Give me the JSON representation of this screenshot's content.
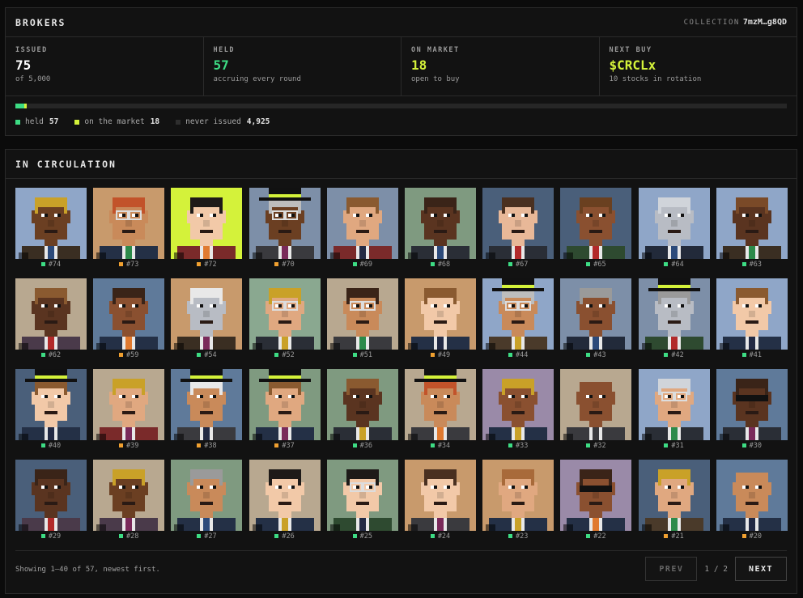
{
  "header": {
    "title": "BROKERS",
    "collection_label": "COLLECTION",
    "collection_id": "7mzM…g8QD"
  },
  "stats": [
    {
      "label": "ISSUED",
      "value": "75",
      "sub": "of 5,000",
      "color": "#ffffff"
    },
    {
      "label": "HELD",
      "value": "57",
      "sub": "accruing every round",
      "color": "#3ddc84"
    },
    {
      "label": "ON MARKET",
      "value": "18",
      "sub": "open to buy",
      "color": "#d4f23a"
    },
    {
      "label": "NEXT BUY",
      "value": "$CRCLx",
      "sub": "10 stocks in rotation",
      "color": "#d4f23a"
    }
  ],
  "supply": {
    "total": 5000,
    "held": 57,
    "market": 18
  },
  "legend": [
    {
      "label": "held",
      "value": "57",
      "color": "#3ddc84"
    },
    {
      "label": "on the market",
      "value": "18",
      "color": "#d4f23a"
    },
    {
      "label": "never issued",
      "value": "4,925",
      "color": "#2e2e2e"
    }
  ],
  "circulation": {
    "title": "IN CIRCULATION",
    "status_colors": {
      "held": "#3ddc84",
      "market": "#f0a030"
    },
    "items": [
      {
        "id": "#74",
        "status": "held",
        "bg": "#8fa6c8",
        "skin": "#6b3f22",
        "hair": "#c9a128",
        "suit": "#3a2e22",
        "tie": "#2c4a7a",
        "hat": "none",
        "glasses": false
      },
      {
        "id": "#73",
        "status": "market",
        "bg": "#c89a6c",
        "skin": "#c98a5a",
        "hair": "#c2532a",
        "suit": "#243046",
        "tie": "#2c8a4a",
        "hat": "none",
        "glasses": true
      },
      {
        "id": "#72",
        "status": "market",
        "bg": "#d4f23a",
        "skin": "#f2c9a8",
        "hair": "#1e1a18",
        "suit": "#7a2a2a",
        "tie": "#e07a30",
        "hat": "none",
        "glasses": false
      },
      {
        "id": "#70",
        "status": "market",
        "bg": "#7d8fa8",
        "skin": "#6b3f22",
        "hair": "#bdbdbd",
        "suit": "#3a3a3e",
        "tie": "#7a2a5a",
        "hat": "top",
        "glasses": true
      },
      {
        "id": "#69",
        "status": "held",
        "bg": "#7d8fa8",
        "skin": "#e0a880",
        "hair": "#8a5a30",
        "suit": "#7a2a2a",
        "tie": "#222a44",
        "hat": "none",
        "glasses": false
      },
      {
        "id": "#68",
        "status": "held",
        "bg": "#7f9a80",
        "skin": "#5a3420",
        "hair": "#3a2418",
        "suit": "#2a2e36",
        "tie": "#2c4a7a",
        "hat": "none",
        "glasses": false
      },
      {
        "id": "#67",
        "status": "held",
        "bg": "#4a5f7a",
        "skin": "#e8b898",
        "hair": "#4a3020",
        "suit": "#2a2e36",
        "tie": "#b22a2a",
        "hat": "none",
        "glasses": false
      },
      {
        "id": "#65",
        "status": "held",
        "bg": "#4a5f7a",
        "skin": "#8a5030",
        "hair": "#6a4020",
        "suit": "#2e4a30",
        "tie": "#b22a2a",
        "hat": "none",
        "glasses": false
      },
      {
        "id": "#64",
        "status": "held",
        "bg": "#8fa6c8",
        "skin": "#b8bcc4",
        "hair": "#d0d4da",
        "suit": "#222a3a",
        "tie": "#2c4a7a",
        "hat": "none",
        "glasses": false
      },
      {
        "id": "#63",
        "status": "held",
        "bg": "#8fa6c8",
        "skin": "#5a3420",
        "hair": "#7a4a28",
        "suit": "#3a2e22",
        "tie": "#2c8a4a",
        "hat": "none",
        "glasses": false
      },
      {
        "id": "#62",
        "status": "held",
        "bg": "#b8a890",
        "skin": "#5a3420",
        "hair": "#8a5a30",
        "suit": "#4a3a4a",
        "tie": "#b22a2a",
        "hat": "none",
        "glasses": false
      },
      {
        "id": "#59",
        "status": "market",
        "bg": "#5f7a9a",
        "skin": "#8a5030",
        "hair": "#3a2418",
        "suit": "#243046",
        "tie": "#e07a30",
        "hat": "none",
        "glasses": false
      },
      {
        "id": "#54",
        "status": "held",
        "bg": "#c89a6c",
        "skin": "#b8bcc4",
        "hair": "#e8e8e8",
        "suit": "#3a2e22",
        "tie": "#7a2a5a",
        "hat": "none",
        "glasses": false
      },
      {
        "id": "#52",
        "status": "held",
        "bg": "#8aa890",
        "skin": "#e0a880",
        "hair": "#c9a128",
        "suit": "#2a2e36",
        "tie": "#c9a128",
        "hat": "none",
        "glasses": true
      },
      {
        "id": "#51",
        "status": "held",
        "bg": "#b8a890",
        "skin": "#c98a5a",
        "hair": "#3a2418",
        "suit": "#3a3a3e",
        "tie": "#2c8a4a",
        "hat": "none",
        "glasses": true
      },
      {
        "id": "#49",
        "status": "market",
        "bg": "#c89a6c",
        "skin": "#f2c9a8",
        "hair": "#8a5a30",
        "suit": "#243046",
        "tie": "#222a44",
        "hat": "none",
        "glasses": false
      },
      {
        "id": "#44",
        "status": "held",
        "bg": "#8fa6c8",
        "skin": "#c98a5a",
        "hair": "#bdbdbd",
        "suit": "#4a3a2a",
        "tie": "#c9a128",
        "hat": "top",
        "glasses": true
      },
      {
        "id": "#43",
        "status": "held",
        "bg": "#7d8fa8",
        "skin": "#8a5030",
        "hair": "#9a9a9a",
        "suit": "#222a3a",
        "tie": "#2c4a7a",
        "hat": "none",
        "glasses": false
      },
      {
        "id": "#42",
        "status": "held",
        "bg": "#7d8fa8",
        "skin": "#b8bcc4",
        "hair": "#9a9a9a",
        "suit": "#2e4a30",
        "tie": "#b22a2a",
        "hat": "top",
        "glasses": false
      },
      {
        "id": "#41",
        "status": "held",
        "bg": "#8fa6c8",
        "skin": "#f2c9a8",
        "hair": "#8a5a30",
        "suit": "#243046",
        "tie": "#222a44",
        "hat": "none",
        "glasses": false
      },
      {
        "id": "#40",
        "status": "held",
        "bg": "#4a5f7a",
        "skin": "#f2c9a8",
        "hair": "#8a5a30",
        "suit": "#243046",
        "tie": "#222a44",
        "hat": "top",
        "glasses": false
      },
      {
        "id": "#39",
        "status": "market",
        "bg": "#b8a890",
        "skin": "#e0a880",
        "hair": "#c9a128",
        "suit": "#7a2a2a",
        "tie": "#7a2a5a",
        "hat": "none",
        "glasses": false
      },
      {
        "id": "#38",
        "status": "market",
        "bg": "#5f7a9a",
        "skin": "#c98a5a",
        "hair": "#e8e8e8",
        "suit": "#3a3a3e",
        "tie": "#222a44",
        "hat": "top",
        "glasses": false
      },
      {
        "id": "#37",
        "status": "market",
        "bg": "#7f9a80",
        "skin": "#e0a880",
        "hair": "#8a5a30",
        "suit": "#243046",
        "tie": "#7a2a5a",
        "hat": "top",
        "glasses": false
      },
      {
        "id": "#36",
        "status": "held",
        "bg": "#7f9a80",
        "skin": "#5a3420",
        "hair": "#8a5a30",
        "suit": "#2a2e36",
        "tie": "#c9a128",
        "hat": "none",
        "glasses": false
      },
      {
        "id": "#34",
        "status": "held",
        "bg": "#b8a890",
        "skin": "#c98a5a",
        "hair": "#c2532a",
        "suit": "#3a3a3e",
        "tie": "#e07a30",
        "hat": "top",
        "glasses": false
      },
      {
        "id": "#33",
        "status": "held",
        "bg": "#9a8aa8",
        "skin": "#8a5030",
        "hair": "#c9a128",
        "suit": "#243046",
        "tie": "#c9a128",
        "hat": "none",
        "glasses": false
      },
      {
        "id": "#32",
        "status": "held",
        "bg": "#b8a890",
        "skin": "#8a5030",
        "hair": "#8a5030",
        "suit": "#3a3a3e",
        "tie": "#3a3a3e",
        "hat": "none",
        "glasses": false
      },
      {
        "id": "#31",
        "status": "held",
        "bg": "#8fa6c8",
        "skin": "#e0a880",
        "hair": "#d0d4da",
        "suit": "#2a2e36",
        "tie": "#2c8a4a",
        "hat": "none",
        "glasses": true
      },
      {
        "id": "#30",
        "status": "held",
        "bg": "#5f7a9a",
        "skin": "#5a3420",
        "hair": "#3a2418",
        "suit": "#2a2e36",
        "tie": "#7a2a5a",
        "hat": "none",
        "glasses": "shades"
      },
      {
        "id": "#29",
        "status": "held",
        "bg": "#4a5f7a",
        "skin": "#5a3420",
        "hair": "#3a2418",
        "suit": "#4a3a4a",
        "tie": "#b22a2a",
        "hat": "none",
        "glasses": false
      },
      {
        "id": "#28",
        "status": "held",
        "bg": "#b8a890",
        "skin": "#6b3f22",
        "hair": "#c9a128",
        "suit": "#4a3a4a",
        "tie": "#7a2a5a",
        "hat": "none",
        "glasses": false
      },
      {
        "id": "#27",
        "status": "held",
        "bg": "#7f9a80",
        "skin": "#c98a5a",
        "hair": "#9a9a9a",
        "suit": "#243046",
        "tie": "#2c4a7a",
        "hat": "none",
        "glasses": false
      },
      {
        "id": "#26",
        "status": "held",
        "bg": "#b8a890",
        "skin": "#f2c9a8",
        "hair": "#1e1a18",
        "suit": "#243046",
        "tie": "#c9a128",
        "hat": "none",
        "glasses": false
      },
      {
        "id": "#25",
        "status": "held",
        "bg": "#7f9a80",
        "skin": "#f2c9a8",
        "hair": "#1e1a18",
        "suit": "#2e4a30",
        "tie": "#222a44",
        "hat": "none",
        "glasses": true
      },
      {
        "id": "#24",
        "status": "held",
        "bg": "#c89a6c",
        "skin": "#f2c9a8",
        "hair": "#4a3020",
        "suit": "#3a3a3e",
        "tie": "#7a2a5a",
        "hat": "none",
        "glasses": false
      },
      {
        "id": "#23",
        "status": "held",
        "bg": "#c89a6c",
        "skin": "#e0a880",
        "hair": "#a86a3a",
        "suit": "#243046",
        "tie": "#c9a128",
        "hat": "none",
        "glasses": false
      },
      {
        "id": "#22",
        "status": "held",
        "bg": "#9a8aa8",
        "skin": "#8a5030",
        "hair": "#3a2418",
        "suit": "#243046",
        "tie": "#e07a30",
        "hat": "none",
        "glasses": "shades"
      },
      {
        "id": "#21",
        "status": "market",
        "bg": "#4a5f7a",
        "skin": "#e0a880",
        "hair": "#c9a128",
        "suit": "#4a3a2a",
        "tie": "#2c8a4a",
        "hat": "none",
        "glasses": false
      },
      {
        "id": "#20",
        "status": "market",
        "bg": "#5f7a9a",
        "skin": "#c98a5a",
        "hair": "#c98a5a",
        "suit": "#243046",
        "tie": "#222a44",
        "hat": "none",
        "glasses": false
      }
    ]
  },
  "footer": {
    "showing": "Showing 1–40 of 57, newest first.",
    "prev": "PREV",
    "page": "1 / 2",
    "next": "NEXT"
  }
}
